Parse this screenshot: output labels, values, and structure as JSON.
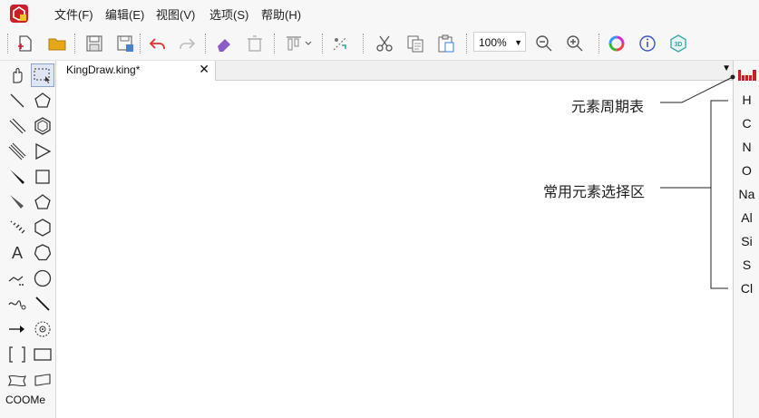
{
  "menu": {
    "items": [
      {
        "label": "文件(F)"
      },
      {
        "label": "编辑(E)"
      },
      {
        "label": "视图(V)"
      },
      {
        "label": "选项(S)"
      },
      {
        "label": "帮助(H)"
      }
    ]
  },
  "toolbar": {
    "zoom_value": "100%",
    "three_d_label": "3D",
    "icons": [
      "new-file-icon",
      "open-folder-icon",
      "save-icon",
      "save-as-icon",
      "undo-icon",
      "redo-icon",
      "eraser-icon",
      "delete-icon",
      "align-icon",
      "flip-icon",
      "cut-icon",
      "copy-icon",
      "paste-icon",
      "zoom-out-icon",
      "zoom-in-icon",
      "color-wheel-icon",
      "info-icon",
      "3d-view-icon"
    ]
  },
  "left_tools": {
    "text_tool_label": "A",
    "coome_label": "COOMe"
  },
  "tabs": {
    "active_title": "KingDraw.king*",
    "close_glyph": "✕",
    "dropdown_glyph": "▼"
  },
  "right_panel": {
    "elements": [
      "H",
      "C",
      "N",
      "O",
      "Na",
      "Al",
      "Si",
      "S",
      "Cl"
    ]
  },
  "callouts": {
    "periodic_table": "元素周期表",
    "common_elements": "常用元素选择区"
  },
  "colors": {
    "brand_red": "#c8202a",
    "folder_yellow": "#e6a817",
    "undo_red": "#d33",
    "eraser_purple": "#8b5cc7",
    "info_blue": "#3a57c4",
    "three_d_teal": "#3aa6a0"
  }
}
